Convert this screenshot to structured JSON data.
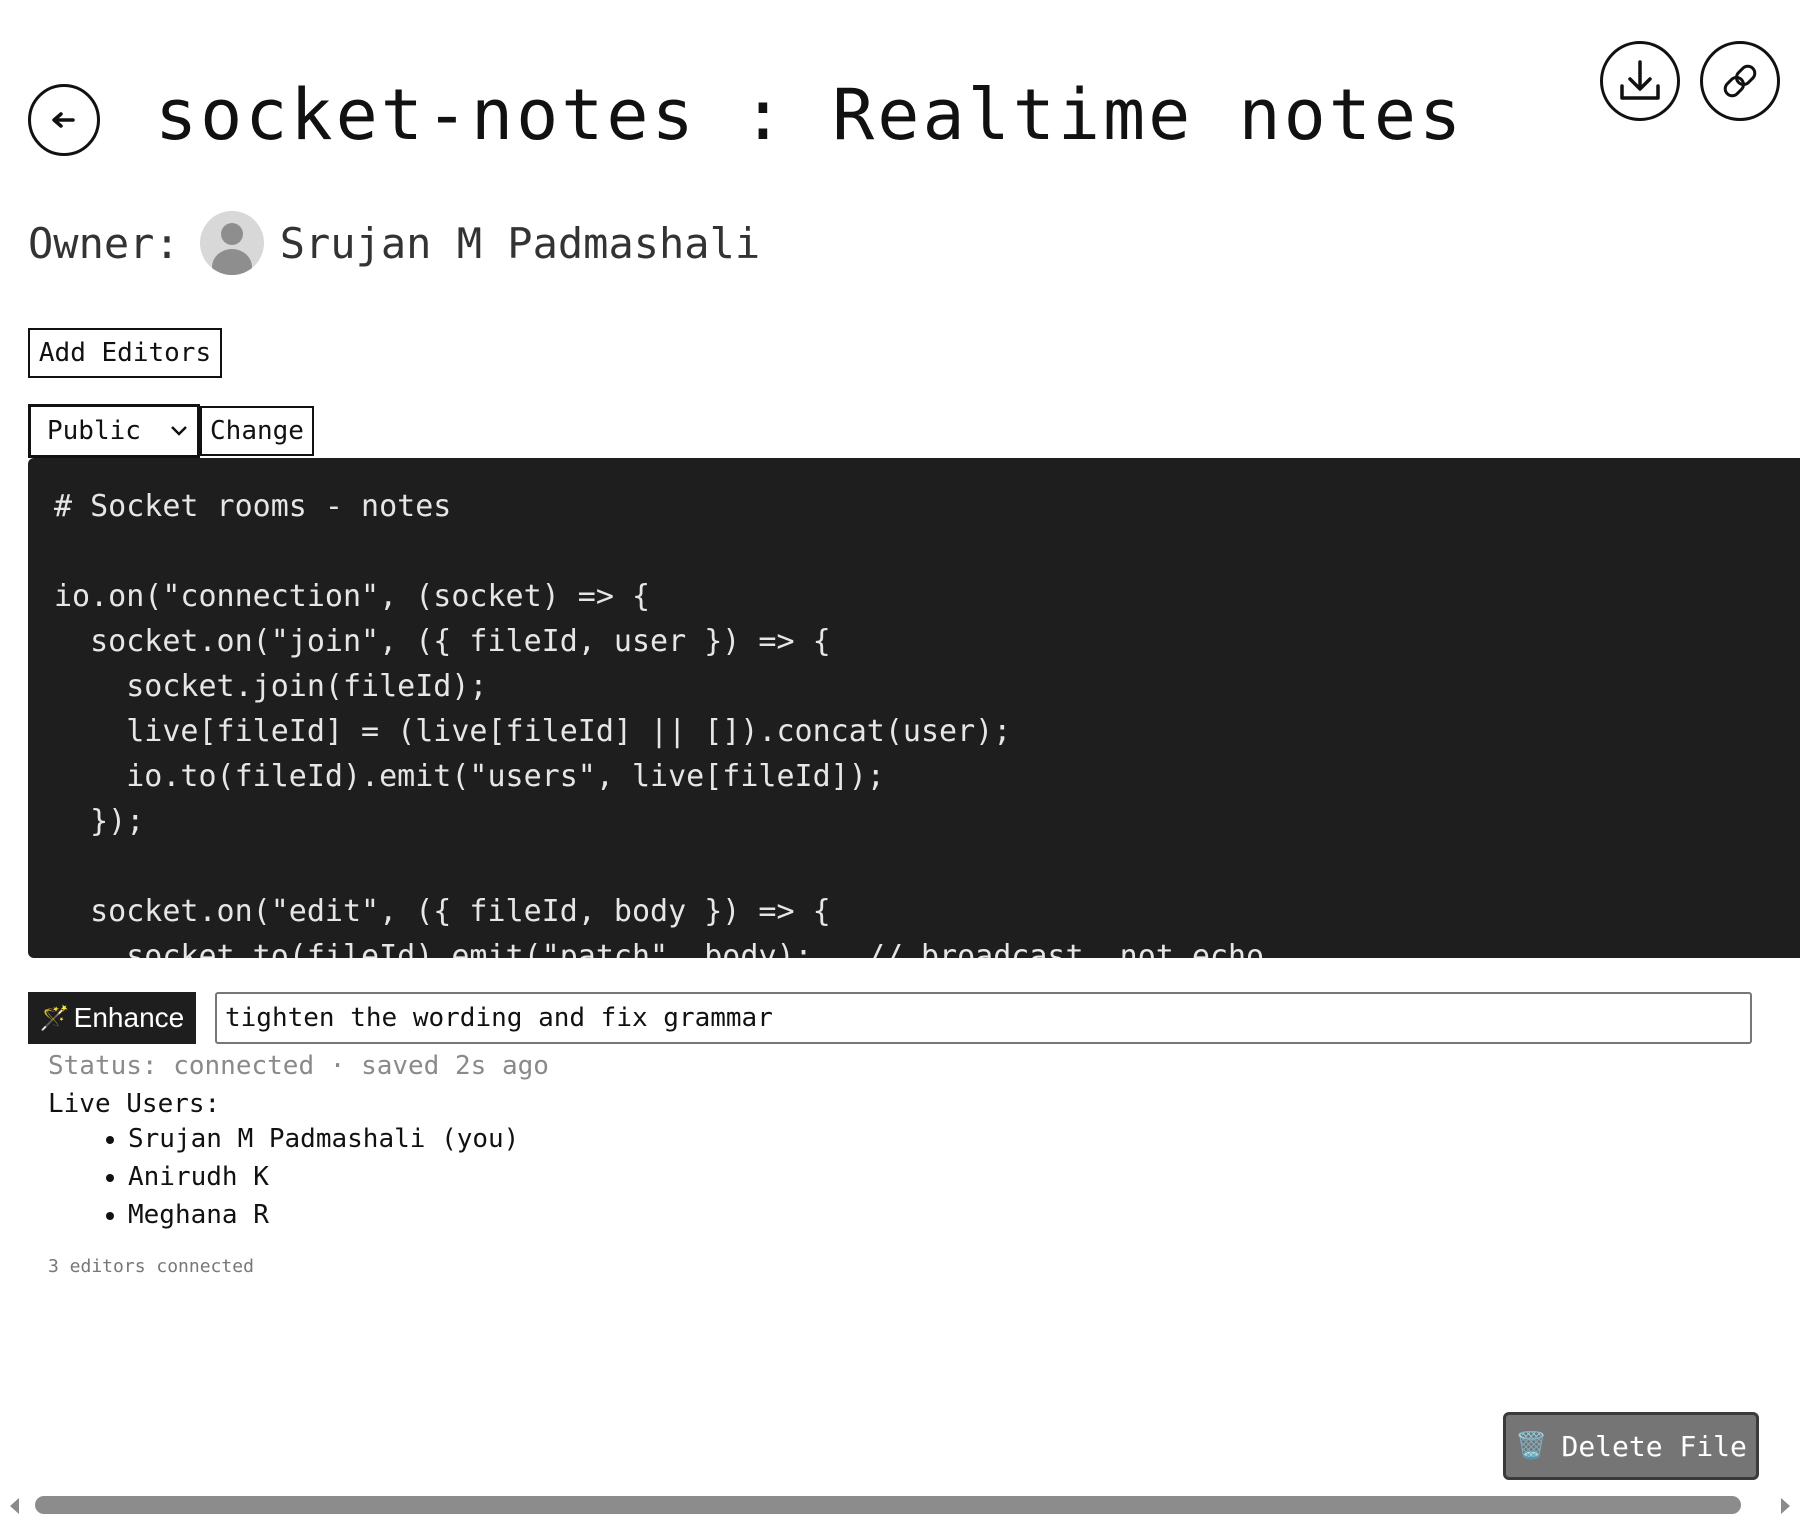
{
  "header": {
    "title": "socket-notes : Realtime notes",
    "back_icon": "back-arrow-icon",
    "download_icon": "download-icon",
    "link_icon": "link-icon"
  },
  "owner": {
    "label": "Owner:",
    "name": "Srujan M Padmashali",
    "avatar_icon": "user-avatar-icon"
  },
  "controls": {
    "add_editors_label": "Add Editors",
    "visibility_selected": "Public",
    "change_label": "Change"
  },
  "editor": {
    "code": "# Socket rooms - notes\n\nio.on(\"connection\", (socket) => {\n  socket.on(\"join\", ({ fileId, user }) => {\n    socket.join(fileId);\n    live[fileId] = (live[fileId] || []).concat(user);\n    io.to(fileId).emit(\"users\", live[fileId]);\n  });\n\n  socket.on(\"edit\", ({ fileId, body }) => {\n    socket.to(fileId).emit(\"patch\", body);   // broadcast, not echo"
  },
  "enhance": {
    "button_label": "Enhance",
    "wand_icon": "🪄",
    "prompt_value": "tighten the wording and fix grammar"
  },
  "status": {
    "text": "Status: connected · saved 2s ago"
  },
  "live_users": {
    "label": "Live Users:",
    "users": [
      "Srujan M Padmashali (you)",
      "Anirudh K",
      "Meghana R"
    ],
    "count_text": "3 editors connected"
  },
  "actions": {
    "delete_label": "Delete File",
    "trash_icon": "🗑️"
  },
  "colors": {
    "editor_bg": "#1e1e1e",
    "delete_bg": "#757575",
    "status_text": "#8a8a8a"
  }
}
